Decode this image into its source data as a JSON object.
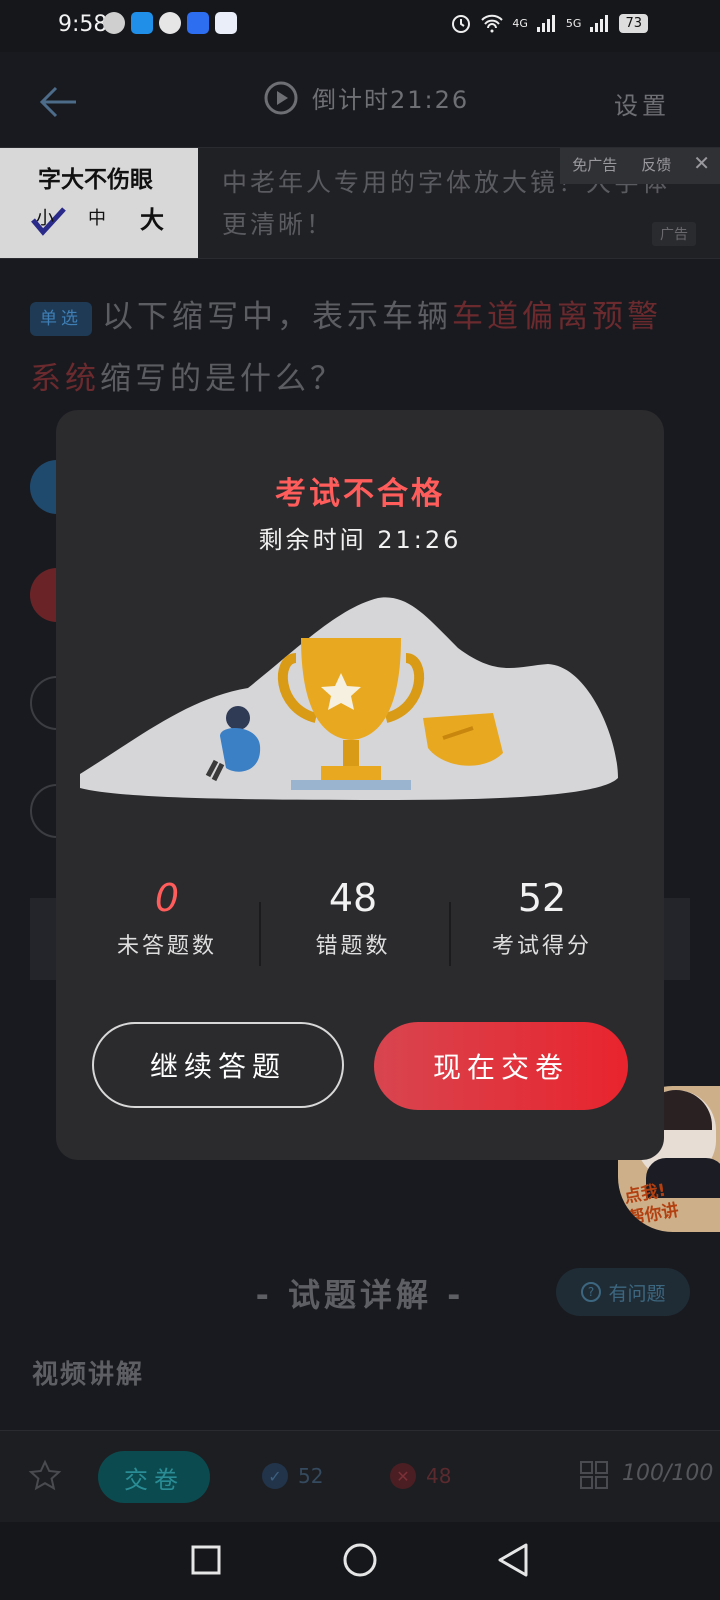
{
  "status_bar": {
    "time": "9:58",
    "net1": "4G",
    "net2": "5G",
    "battery": "73"
  },
  "topbar": {
    "countdown": "倒计时21:26",
    "settings": "设置"
  },
  "ad": {
    "thumb_title": "字大不伤眼",
    "size_small": "小",
    "size_medium": "中",
    "size_large": "大",
    "text": "中老年人专用的字体放大镜！大字体更清晰！",
    "remove_ad": "免广告",
    "feedback": "反馈",
    "ad_label": "广告"
  },
  "question": {
    "type_badge": "单选",
    "text_before": "以下缩写中，表示车辆",
    "highlight": "车道偏离预警系统",
    "text_after": "缩写的是什么？"
  },
  "modal": {
    "title": "考试不合格",
    "remaining_time": "剩余时间 21:26",
    "stats": [
      {
        "value": "0",
        "label": "未答题数",
        "color": "#ff5c5c"
      },
      {
        "value": "48",
        "label": "错题数",
        "color": "#f2f2f2"
      },
      {
        "value": "52",
        "label": "考试得分",
        "color": "#f2f2f2"
      }
    ],
    "continue_label": "继续答题",
    "submit_label": "现在交卷"
  },
  "explanation": {
    "title": "- 试题详解 -",
    "help_label": "有问题",
    "video_label": "视频讲解"
  },
  "helper": {
    "line1": "点我!",
    "line2": "帮你讲"
  },
  "bottombar": {
    "submit_label": "交卷",
    "correct_count": "52",
    "wrong_count": "48",
    "progress": "100/100"
  },
  "colors": {
    "fail_red": "#ff5c5c",
    "submit_gradient_start": "#d8454f",
    "submit_gradient_end": "#e8242e",
    "modal_bg": "#2b2b2e"
  }
}
